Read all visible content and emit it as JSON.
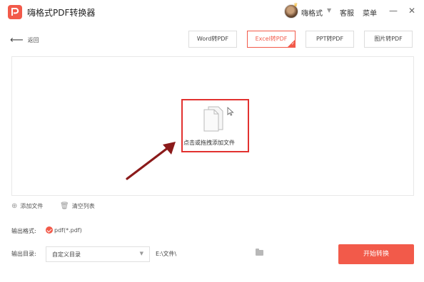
{
  "app": {
    "title": "嗨格式PDF转换器"
  },
  "header": {
    "username": "嗨格式",
    "support_label": "客服",
    "menu_label": "菜单",
    "minimize_glyph": "—",
    "close_glyph": "✕"
  },
  "toolbar": {
    "back_label": "返回",
    "tabs": [
      {
        "label": "Word转PDF",
        "active": false
      },
      {
        "label": "Excel转PDF",
        "active": true
      },
      {
        "label": "PPT转PDF",
        "active": false
      },
      {
        "label": "图片转PDF",
        "active": false
      }
    ]
  },
  "dropzone": {
    "label": "点击或拖拽添加文件"
  },
  "actions": {
    "add_file": "添加文件",
    "clear_list": "清空列表"
  },
  "output": {
    "format_label": "输出格式:",
    "format_value": "pdf(*.pdf)",
    "dir_label": "输出目录:",
    "dir_select": "自定义目录",
    "dir_path": "E:\\文件\\",
    "start_button": "开始转换"
  },
  "colors": {
    "accent": "#f25a4a",
    "annotation": "#e2312f",
    "arrow": "#8b1a1a"
  }
}
